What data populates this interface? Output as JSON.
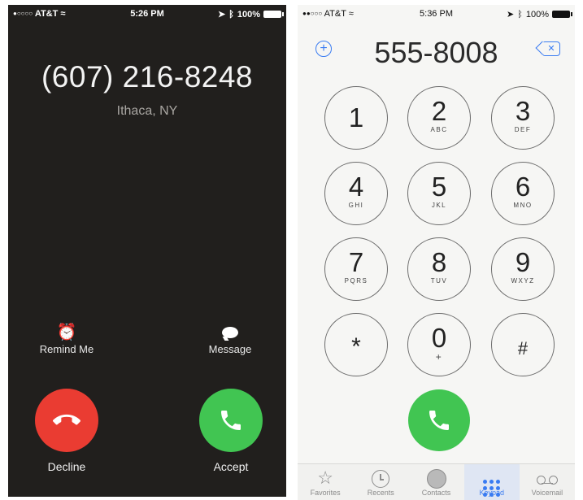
{
  "incoming": {
    "status": {
      "carrier": "AT&T",
      "time": "5:26 PM",
      "battery": "100%"
    },
    "caller_number": "(607) 216-8248",
    "caller_location": "Ithaca, NY",
    "remind_label": "Remind Me",
    "message_label": "Message",
    "decline_label": "Decline",
    "accept_label": "Accept",
    "colors": {
      "background": "#211f1d",
      "decline": "#ea3c32",
      "accept": "#41c552"
    }
  },
  "dialer": {
    "status": {
      "carrier": "AT&T",
      "time": "5:36 PM",
      "battery": "100%"
    },
    "number": "555-8008",
    "keys": [
      {
        "digit": "1",
        "letters": ""
      },
      {
        "digit": "2",
        "letters": "ABC"
      },
      {
        "digit": "3",
        "letters": "DEF"
      },
      {
        "digit": "4",
        "letters": "GHI"
      },
      {
        "digit": "5",
        "letters": "JKL"
      },
      {
        "digit": "6",
        "letters": "MNO"
      },
      {
        "digit": "7",
        "letters": "PQRS"
      },
      {
        "digit": "8",
        "letters": "TUV"
      },
      {
        "digit": "9",
        "letters": "WXYZ"
      },
      {
        "digit": "*",
        "letters": ""
      },
      {
        "digit": "0",
        "letters": "+"
      },
      {
        "digit": "#",
        "letters": ""
      }
    ],
    "tabs": [
      {
        "label": "Favorites",
        "icon": "star-icon"
      },
      {
        "label": "Recents",
        "icon": "clock-icon"
      },
      {
        "label": "Contacts",
        "icon": "contact-icon"
      },
      {
        "label": "Keypad",
        "icon": "keypad-icon",
        "active": true
      },
      {
        "label": "Voicemail",
        "icon": "voicemail-icon"
      }
    ],
    "colors": {
      "accent": "#3a7cf2",
      "call": "#41c552",
      "background": "#f6f6f4"
    }
  }
}
